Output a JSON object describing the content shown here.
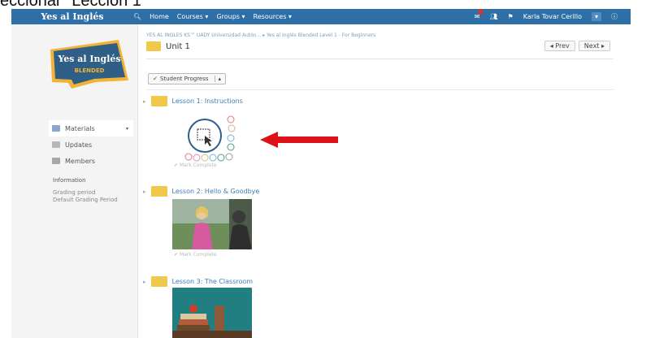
{
  "caption": "eccionar \"Leccion 1\"",
  "topbar": {
    "brand": "Yes al Inglés",
    "nav": [
      "Home",
      "Courses ▾",
      "Groups ▾",
      "Resources ▾"
    ],
    "user": "Karla Tovar Cerillo"
  },
  "sidebar": {
    "logo_top": "Yes al Inglés",
    "logo_bottom": "BLENDED",
    "items": [
      {
        "label": "Materials",
        "icon": "book-icon"
      },
      {
        "label": "Updates",
        "icon": "updates-icon"
      },
      {
        "label": "Members",
        "icon": "members-icon"
      }
    ],
    "info_heading": "Information",
    "grading_label": "Grading period",
    "grading_value": "Default Grading Period"
  },
  "main": {
    "breadcrumb": "YES AL INGLES KS™ UADY Universidad Autón... ▸ Yes al Inglés Blended Level 1 - For Beginners",
    "unit_title": "Unit 1",
    "prev": "◂ Prev",
    "next": "Next ▸",
    "student_progress": "Student Progress",
    "lessons": [
      {
        "title": "Lesson 1: Instructions",
        "mark": "Mark Complete"
      },
      {
        "title": "Lesson 2: Hello & Goodbye",
        "mark": "Mark Complete"
      },
      {
        "title": "Lesson 3: The Classroom"
      }
    ]
  },
  "colors": {
    "topbar": "#2d6fa6",
    "folder": "#f1c94a",
    "link": "#3f7cb6",
    "arrow": "#e0101a"
  }
}
